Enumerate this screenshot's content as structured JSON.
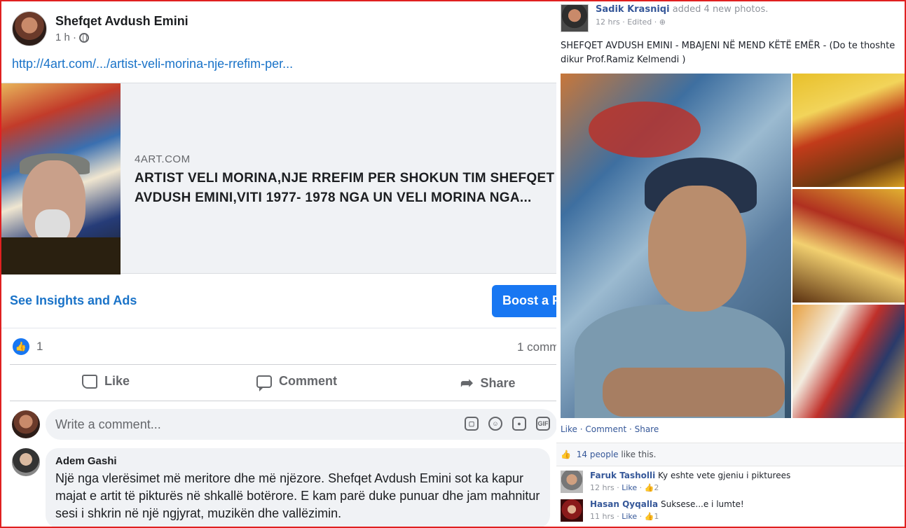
{
  "left_post": {
    "author": "Shefqet Avdush Emini",
    "time": "1 h ·",
    "link": "http://4art.com/.../artist-veli-morina-nje-rrefim-per...",
    "preview": {
      "source": "4ART.COM",
      "title_line1": "ARTIST VELI MORINA,NJE RREFIM PER SHOKUN TIM SHEFQET",
      "title_line2": "AVDUSH EMINI,VITI 1977- 1978 NGA UN VELI MORINA NGA..."
    },
    "insights_label": "See Insights and Ads",
    "boost_label": "Boost a P",
    "reaction_count": "1",
    "comment_count": "1 comm",
    "actions": {
      "like": "Like",
      "comment": "Comment",
      "share": "Share"
    },
    "composer_placeholder": "Write a comment...",
    "comment": {
      "author": "Adem Gashi",
      "text": "Një nga vlerësimet më meritore dhe më njëzore. Shefqet Avdush Emini sot ka kapur majat e artit të pikturës në shkallë botërore. E kam parë duke punuar dhe jam mahnitur sesi i shkrin në një ngjyrat, muzikën dhe vallëzimin."
    }
  },
  "right_post": {
    "author": "Sadik Krasniqi",
    "action_text": "added 4 new photos.",
    "meta": "12 hrs · Edited ·",
    "caption": "SHEFQET AVDUSH EMINI - MBAJENI NË MEND KËTË EMËR - (Do te thoshte dikur Prof.Ramiz Kelmendi )",
    "actions": "Like · Comment · Share",
    "likes_link": "14 people",
    "likes_suffix": "like this.",
    "comments": [
      {
        "author": "Faruk Tasholli",
        "text": "Ky eshte vete gjeniu i pikturees",
        "time": "12 hrs",
        "like": "Like",
        "count": "2"
      },
      {
        "author": "Hasan Qyqalla",
        "text": "Suksese...e i lumte!",
        "time": "11 hrs",
        "like": "Like",
        "count": "1"
      }
    ]
  },
  "colors": {
    "accent": "#1877f2",
    "link": "#365899",
    "frame": "#e02020"
  }
}
